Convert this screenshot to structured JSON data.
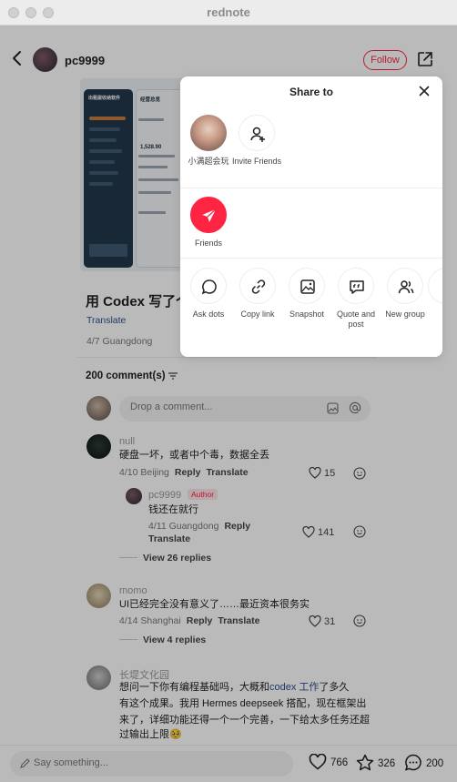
{
  "window": {
    "title": "rednote"
  },
  "header": {
    "author": "pc9999",
    "follow_label": "Follow"
  },
  "post_preview": {
    "phone1_title": "出租屋收纳软件",
    "phone2_title": "经营总览",
    "amount": "1,528.90"
  },
  "post": {
    "title": "用 Codex 写了个…",
    "translate": "Translate",
    "date": "4/7 Guangdong"
  },
  "comments_section": {
    "count_label": "200 comment(s)",
    "input_placeholder": "Drop a comment..."
  },
  "comments": [
    {
      "name": "null",
      "text": "硬盘一坏，或者中个毒，数据全丢",
      "date": "4/10 Beijing",
      "reply": "Reply",
      "translate": "Translate",
      "likes": "15"
    },
    {
      "name": "pc9999",
      "badge": "Author",
      "text": "钱还在就行",
      "date": "4/11 Guangdong",
      "reply": "Reply",
      "translate": "Translate",
      "likes": "141",
      "view_replies": "View 26 replies"
    },
    {
      "name": "momo",
      "text": "UI已经完全没有意义了……最近资本很务实",
      "date": "4/14 Shanghai",
      "reply": "Reply",
      "translate": "Translate",
      "likes": "31",
      "view_replies": "View 4 replies"
    },
    {
      "name": "长堤文化园",
      "text_part1": "想问一下你有编程基础吗，大概和",
      "text_link": "codex 工作",
      "text_part2": "了多久",
      "text_line2": "有这个成果。我用 Hermes deepseek 搭配，现在框架出",
      "text_line3": "来了，详细功能还得一个一个完善，一下给太多任务还超",
      "text_line4": "过输出上限🥺"
    }
  ],
  "bottom_bar": {
    "say_placeholder": "Say something...",
    "likes": "766",
    "stars": "326",
    "comments": "200"
  },
  "share_panel": {
    "title": "Share to",
    "contacts": [
      {
        "label": "小满超会玩"
      },
      {
        "label": "Invite Friends"
      }
    ],
    "friends_label": "Friends",
    "actions": [
      {
        "label": "Ask dots",
        "icon": "chat-bubble-icon"
      },
      {
        "label": "Copy link",
        "icon": "link-icon"
      },
      {
        "label": "Snapshot",
        "icon": "image-icon"
      },
      {
        "label": "Quote and post",
        "icon": "quote-icon"
      },
      {
        "label": "New group",
        "icon": "group-icon"
      }
    ]
  },
  "colors": {
    "brand": "#ff2442",
    "link": "#2d4f8f"
  }
}
